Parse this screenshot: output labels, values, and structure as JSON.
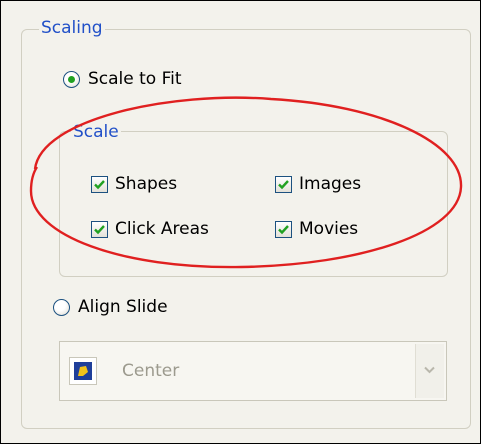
{
  "groups": {
    "scaling_title": "Scaling",
    "scale_title": "Scale"
  },
  "radios": {
    "scale_to_fit": {
      "label": "Scale to Fit",
      "selected": true
    },
    "align_slide": {
      "label": "Align Slide",
      "selected": false
    }
  },
  "checkboxes": {
    "shapes": {
      "label": "Shapes",
      "checked": true
    },
    "images": {
      "label": "Images",
      "checked": true
    },
    "click_areas": {
      "label": "Click Areas",
      "checked": true
    },
    "movies": {
      "label": "Movies",
      "checked": true
    }
  },
  "dropdown": {
    "selected": "Center",
    "icon": "align-center-icon",
    "disabled": true
  },
  "colors": {
    "group_title": "#2150c8",
    "check_mark": "#21a121",
    "annotation": "#e02020"
  }
}
